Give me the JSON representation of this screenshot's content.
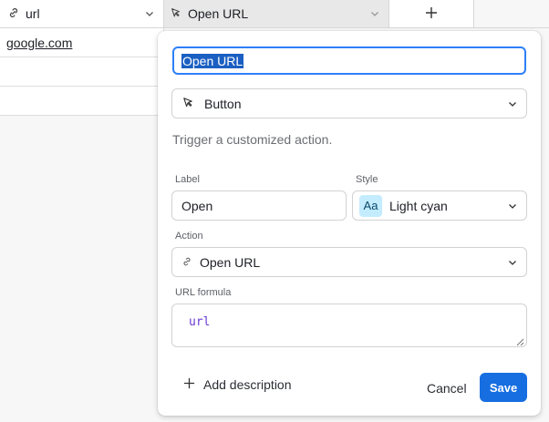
{
  "grid": {
    "columns": [
      {
        "name": "url"
      },
      {
        "name": "Open URL"
      }
    ],
    "rows": [
      {
        "url": "google.com"
      },
      {
        "url": ""
      },
      {
        "url": ""
      }
    ]
  },
  "panel": {
    "field_name": "Open URL",
    "field_type": "Button",
    "hint": "Trigger a customized action.",
    "label_caption": "Label",
    "label_value": "Open",
    "style_caption": "Style",
    "style_swatch": "Aa",
    "style_value": "Light cyan",
    "style_color": "#c4ecff",
    "action_caption": "Action",
    "action_value": "Open URL",
    "formula_caption": "URL formula",
    "formula_value": "url",
    "add_description": "Add description",
    "cancel": "Cancel",
    "save": "Save",
    "accent": "#166ee1"
  }
}
